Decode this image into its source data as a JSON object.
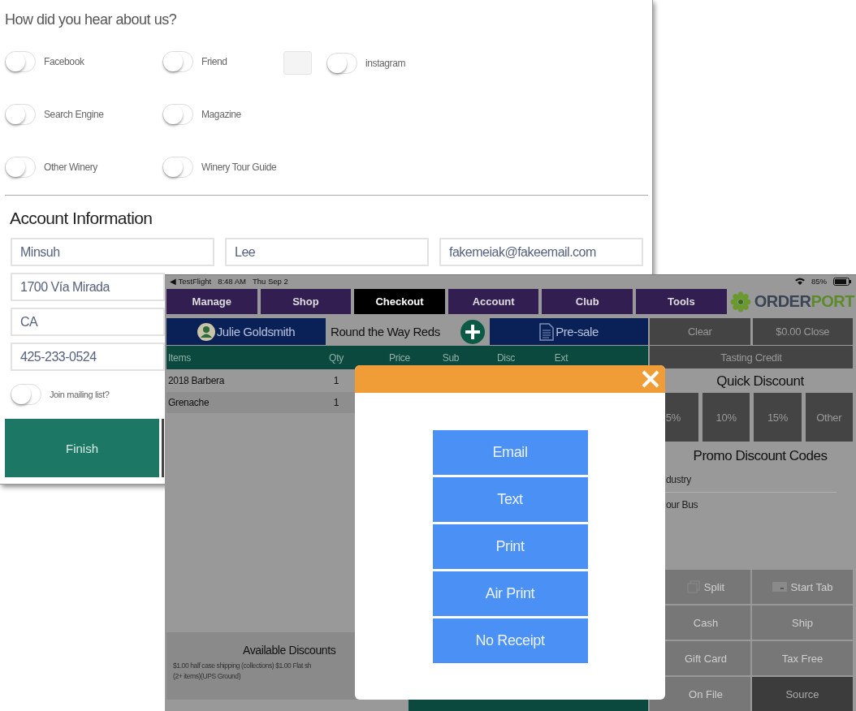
{
  "form": {
    "heading": "How did you hear about us?",
    "source_rows": [
      [
        {
          "label": "Facebook",
          "on": false
        },
        {
          "label": "Friend",
          "on": false
        },
        {
          "label": "instagram",
          "on": false,
          "kind": "boxed"
        }
      ],
      [
        {
          "label": "Search Engine",
          "on": false
        },
        {
          "label": "Magazine",
          "on": false
        }
      ],
      [
        {
          "label": "Other Winery",
          "on": false
        },
        {
          "label": "Winery Tour Guide",
          "on": false
        }
      ]
    ],
    "section_title": "Account Information",
    "name_fields": [
      {
        "value": "Minsuh"
      },
      {
        "value": "Lee"
      },
      {
        "value": "fakemeiak@fakeemail.com"
      }
    ],
    "address_fields": [
      {
        "value": "1700 Vía Mirada"
      },
      {
        "value": "CA"
      },
      {
        "value": "425-233-0524"
      }
    ],
    "mailing_list": {
      "label": "Join mailing list?",
      "on": false
    },
    "finish_button": "Finish"
  },
  "pos": {
    "status_bar": {
      "back": "◀ TestFlight",
      "time": "8:48 AM",
      "date": "Thu Sep 2",
      "battery": "85%"
    },
    "nav_tabs": [
      {
        "label": "Manage",
        "selected": false
      },
      {
        "label": "Shop",
        "selected": false
      },
      {
        "label": "Checkout",
        "selected": true
      },
      {
        "label": "Account",
        "selected": false
      },
      {
        "label": "Club",
        "selected": false
      },
      {
        "label": "Tools",
        "selected": false
      }
    ],
    "logo": {
      "text": "ORDER",
      "accent": "PORT"
    },
    "customer_button": "Julie Goldsmith",
    "club_name": "Round the Way Reds",
    "presale_button": "Pre-sale",
    "clear_button": "Clear",
    "close_button": "$0.00 Close",
    "tasting_button": "Tasting Credit",
    "columns": [
      "Items",
      "Qty",
      "Price",
      "Sub",
      "Disc",
      "Ext"
    ],
    "rows": [
      {
        "item": "2018 Barbera",
        "qty": "1"
      },
      {
        "item": "Grenache",
        "qty": "1"
      }
    ],
    "discounts": {
      "title": "Available Discounts",
      "lines": [
        "$1.00 half case shipping (collections) $1.00 Flat sh",
        "(2+ items)(UPS Ground)"
      ]
    },
    "quick_discount": {
      "title": "Quick Discount",
      "options": [
        "5%",
        "10%",
        "15%",
        "Other"
      ]
    },
    "promo": {
      "title": "Promo Discount Codes",
      "codes": [
        "dustry",
        "our Bus"
      ]
    },
    "actions": [
      {
        "label": "Split",
        "kind": "split",
        "selected": false
      },
      {
        "label": "Start Tab",
        "kind": "tab",
        "selected": false
      },
      {
        "label": "Cash",
        "kind": "plain",
        "selected": false
      },
      {
        "label": "Ship",
        "kind": "plain",
        "selected": false
      },
      {
        "label": "Gift Card",
        "kind": "plain",
        "selected": false
      },
      {
        "label": "Tax Free",
        "kind": "plain",
        "selected": false
      },
      {
        "label": "On File",
        "kind": "plain",
        "selected": false
      },
      {
        "label": "Source",
        "kind": "plain",
        "selected": true
      }
    ]
  },
  "receipt_dialog": {
    "options": [
      "Email",
      "Text",
      "Print",
      "Air Print",
      "No Receipt"
    ]
  }
}
